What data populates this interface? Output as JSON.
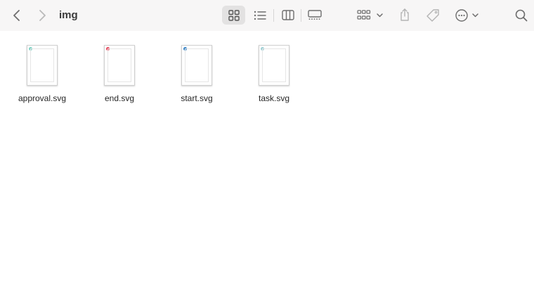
{
  "window": {
    "title": "img"
  },
  "toolbar": {
    "back_icon": "chevron-left-icon",
    "forward_icon": "chevron-right-icon",
    "view_modes": [
      "icon-view",
      "list-view",
      "column-view",
      "gallery-view"
    ],
    "selected_view": "icon-view",
    "group_icon": "group-grid-icon",
    "share_icon": "share-icon",
    "tag_icon": "tag-icon",
    "more_icon": "ellipsis-circle-icon",
    "search_icon": "search-icon"
  },
  "files": [
    {
      "name": "approval.svg",
      "accent": "#7fd3c6"
    },
    {
      "name": "end.svg",
      "accent": "#e84a5f"
    },
    {
      "name": "start.svg",
      "accent": "#3a86c8"
    },
    {
      "name": "task.svg",
      "accent": "#9ed0d6"
    }
  ],
  "colors": {
    "toolbar_bg": "#f7f6f6",
    "selected_view_bg": "#e3e2e2",
    "icon": "#6e6e6e"
  }
}
